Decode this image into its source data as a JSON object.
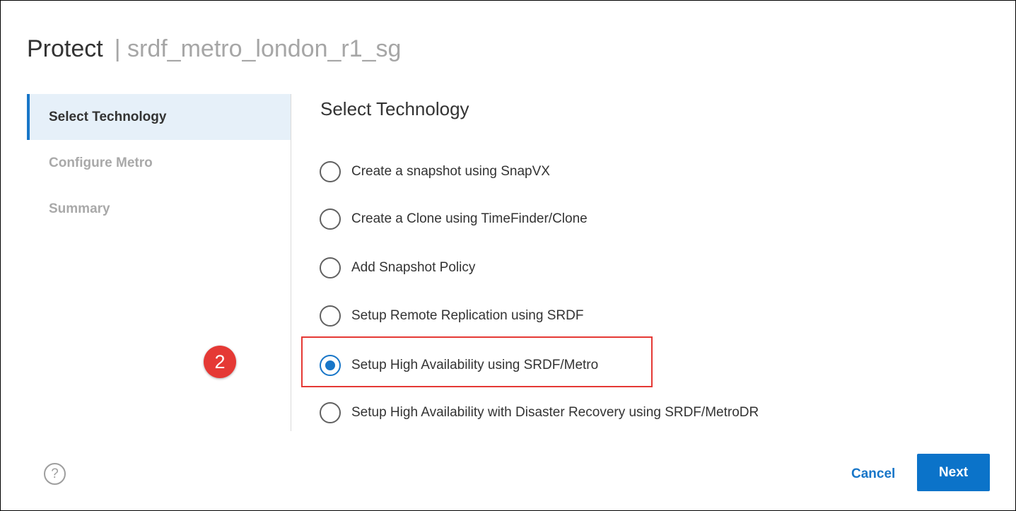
{
  "dialog": {
    "title": "Protect",
    "subtitle": "| srdf_metro_london_r1_sg"
  },
  "steps": [
    {
      "label": "Select Technology",
      "active": true
    },
    {
      "label": "Configure Metro",
      "active": false
    },
    {
      "label": "Summary",
      "active": false
    }
  ],
  "content": {
    "section_title": "Select Technology",
    "options": [
      {
        "label": "Create a snapshot using SnapVX",
        "selected": false
      },
      {
        "label": "Create a Clone using TimeFinder/Clone",
        "selected": false
      },
      {
        "label": "Add Snapshot Policy",
        "selected": false
      },
      {
        "label": "Setup Remote Replication using SRDF",
        "selected": false
      },
      {
        "label": "Setup High Availability using SRDF/Metro",
        "selected": true
      },
      {
        "label": "Setup High Availability with Disaster Recovery using SRDF/MetroDR",
        "selected": false
      }
    ]
  },
  "annotation": {
    "callout_number": "2",
    "highlight_color": "#e53935"
  },
  "footer": {
    "help_icon": "help-circle-icon",
    "help_glyph": "?",
    "cancel_label": "Cancel",
    "next_label": "Next"
  },
  "colors": {
    "accent": "#1876c8",
    "active_step_bg": "#e6f0f9"
  }
}
